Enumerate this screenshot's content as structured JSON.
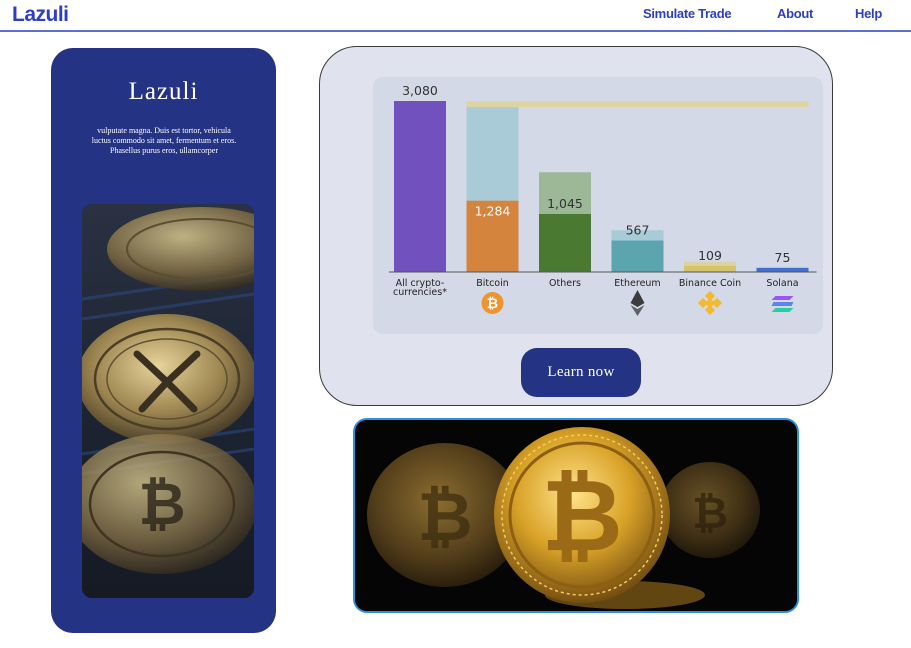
{
  "header": {
    "brand": "Lazuli",
    "nav": [
      "Simulate Trade",
      "About",
      "Help"
    ]
  },
  "sidebar": {
    "title": "Lazuli",
    "text": "vulputate magna. Duis est tortor, vehicula luctus commodo sit amet, fermentum et eros. Phasellus purus eros, ullamcorper"
  },
  "main": {
    "learn_button": "Learn now"
  },
  "colors": {
    "brand_blue": "#2c3fc4",
    "card_navy": "#243383",
    "photo_border": "#2f8fe0"
  },
  "chart_data": {
    "type": "bar",
    "categories": [
      "All crypto-currencies*",
      "Bitcoin",
      "Others",
      "Ethereum",
      "Binance Coin",
      "Solana"
    ],
    "category_lines": [
      [
        "All crypto-",
        "currencies*"
      ],
      [
        "Bitcoin"
      ],
      [
        "Others"
      ],
      [
        "Ethereum"
      ],
      [
        "Binance Coin"
      ],
      [
        "Solana"
      ]
    ],
    "values": [
      3080,
      1284,
      1045,
      567,
      109,
      75
    ],
    "value_labels": [
      "3,080",
      "1,284",
      "1,045",
      "567",
      "109",
      "75"
    ],
    "bar_colors": [
      "#7051bd",
      "#d4843c",
      "#4a7a32",
      "#5aa5ae",
      "#d6c567",
      "#3f6fcf"
    ],
    "ylim": [
      0,
      3080
    ],
    "icons": [
      "",
      "bitcoin-icon",
      "",
      "ethereum-icon",
      "binance-coin-icon",
      "solana-icon"
    ],
    "title": "",
    "xlabel": "",
    "ylabel": ""
  }
}
